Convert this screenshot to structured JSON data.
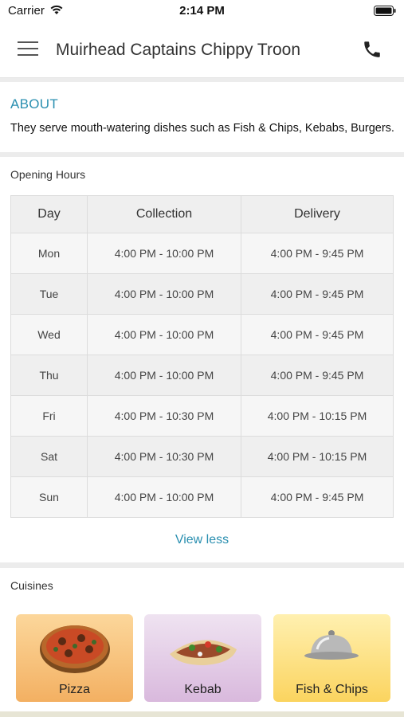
{
  "status_bar": {
    "carrier": "Carrier",
    "time": "2:14 PM"
  },
  "header": {
    "title": "Muirhead Captains Chippy Troon"
  },
  "about": {
    "heading": "ABOUT",
    "description": "They serve mouth-watering dishes such as Fish & Chips, Kebabs, Burgers."
  },
  "opening_hours": {
    "label": "Opening Hours",
    "columns": [
      "Day",
      "Collection",
      "Delivery"
    ],
    "rows": [
      [
        "Mon",
        "4:00 PM - 10:00 PM",
        "4:00 PM - 9:45 PM"
      ],
      [
        "Tue",
        "4:00 PM - 10:00 PM",
        "4:00 PM - 9:45 PM"
      ],
      [
        "Wed",
        "4:00 PM - 10:00 PM",
        "4:00 PM - 9:45 PM"
      ],
      [
        "Thu",
        "4:00 PM - 10:00 PM",
        "4:00 PM - 9:45 PM"
      ],
      [
        "Fri",
        "4:00 PM - 10:30 PM",
        "4:00 PM - 10:15 PM"
      ],
      [
        "Sat",
        "4:00 PM - 10:30 PM",
        "4:00 PM - 10:15 PM"
      ],
      [
        "Sun",
        "4:00 PM - 10:00 PM",
        "4:00 PM - 9:45 PM"
      ]
    ],
    "toggle_label": "View less"
  },
  "cuisines": {
    "label": "Cuisines",
    "items": [
      {
        "label": "Pizza",
        "icon": "pizza-icon"
      },
      {
        "label": "Kebab",
        "icon": "kebab-icon"
      },
      {
        "label": "Fish & Chips",
        "icon": "cloche-icon"
      }
    ]
  },
  "colors": {
    "accent": "#2a8fb0"
  }
}
